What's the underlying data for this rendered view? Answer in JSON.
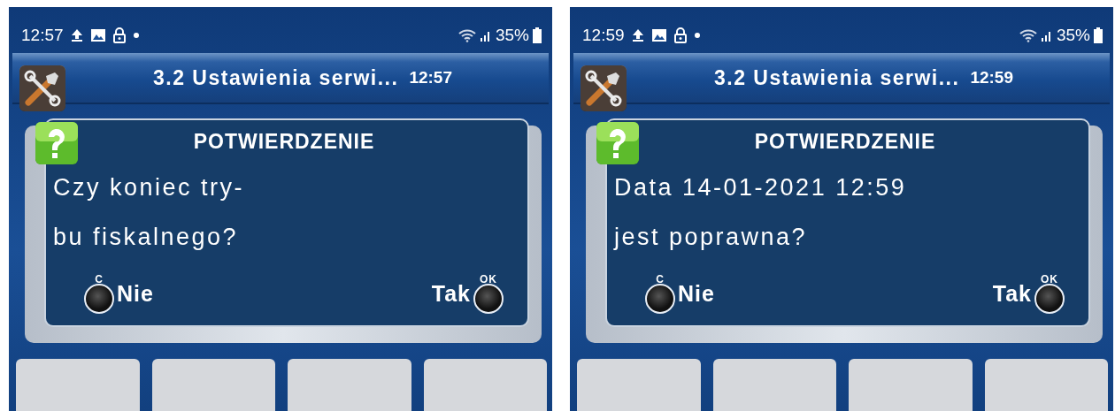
{
  "screens": [
    {
      "status_bar": {
        "time": "12:57",
        "battery": "35%"
      },
      "header": {
        "title": "3.2 Ustawienia serwi...",
        "time": "12:57"
      },
      "dialog": {
        "title": "POTWIERDZENIE",
        "message_lines": [
          "Czy koniec try-",
          "bu fiskalnego?"
        ],
        "buttons": [
          {
            "kind": "cancel",
            "key": "C",
            "label": "Nie"
          },
          {
            "kind": "confirm",
            "key": "OK",
            "label": "Tak"
          }
        ]
      }
    },
    {
      "status_bar": {
        "time": "12:59",
        "battery": "35%"
      },
      "header": {
        "title": "3.2 Ustawienia serwi...",
        "time": "12:59"
      },
      "dialog": {
        "title": "POTWIERDZENIE",
        "message_lines": [
          "Data 14-01-2021 12:59",
          "jest poprawna?"
        ],
        "buttons": [
          {
            "kind": "cancel",
            "key": "C",
            "label": "Nie"
          },
          {
            "kind": "confirm",
            "key": "OK",
            "label": "Tak"
          }
        ]
      }
    }
  ]
}
